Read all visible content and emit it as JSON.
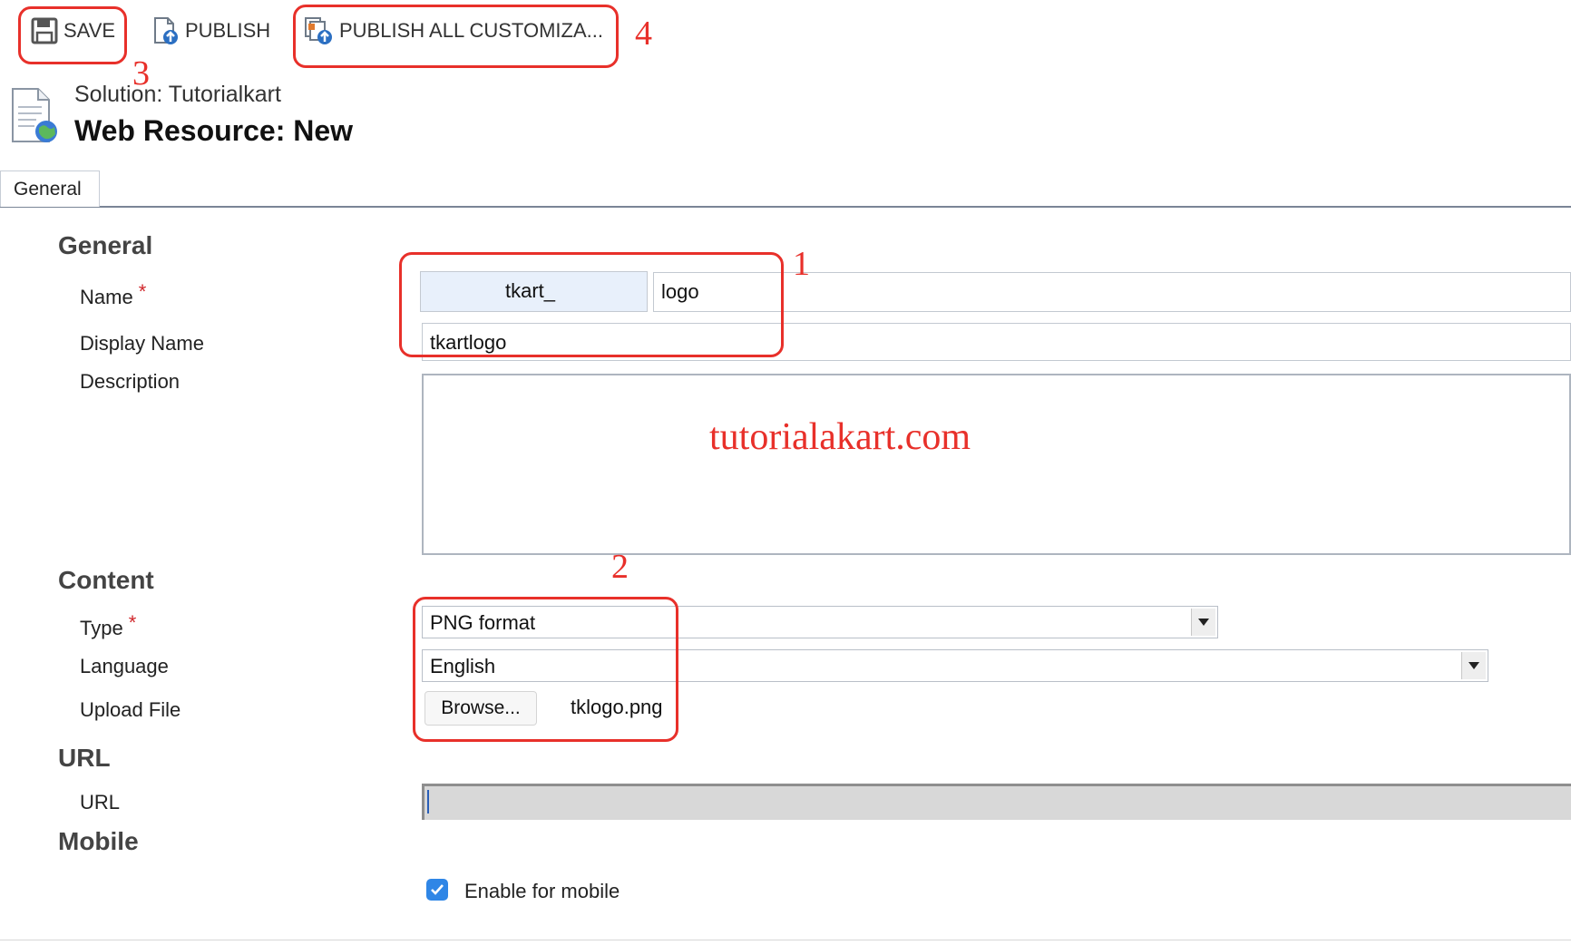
{
  "toolbar": {
    "save_label": "SAVE",
    "publish_label": "PUBLISH",
    "publish_all_label": "PUBLISH ALL CUSTOMIZA..."
  },
  "header": {
    "solution": "Solution: Tutorialkart",
    "title": "Web Resource: New"
  },
  "tabs": [
    {
      "label": "General"
    }
  ],
  "form": {
    "general_section": "General",
    "name_label": "Name",
    "name_prefix": "tkart_",
    "name_value": "logo",
    "display_name_label": "Display Name",
    "display_name_value": "tkartlogo",
    "description_label": "Description",
    "description_value": "",
    "content_section": "Content",
    "type_label": "Type",
    "type_value": "PNG format",
    "language_label": "Language",
    "language_value": "English",
    "upload_label": "Upload File",
    "browse_label": "Browse...",
    "file_name": "tklogo.png",
    "url_section": "URL",
    "url_label": "URL",
    "url_value": "",
    "mobile_section": "Mobile",
    "enable_mobile_label": "Enable for mobile",
    "enable_mobile_checked": true,
    "required_marker": "*"
  },
  "annotations": {
    "numbers": [
      "1",
      "2",
      "3",
      "4"
    ],
    "watermark": "tutorialakart.com",
    "color": "#e8302a"
  },
  "icons": {
    "save": "floppy-disk-icon",
    "publish": "publish-document-icon",
    "publish_all": "publish-all-icon",
    "page": "web-resource-page-icon",
    "dropdown": "chevron-down-icon",
    "checkbox": "checkmark-icon"
  }
}
